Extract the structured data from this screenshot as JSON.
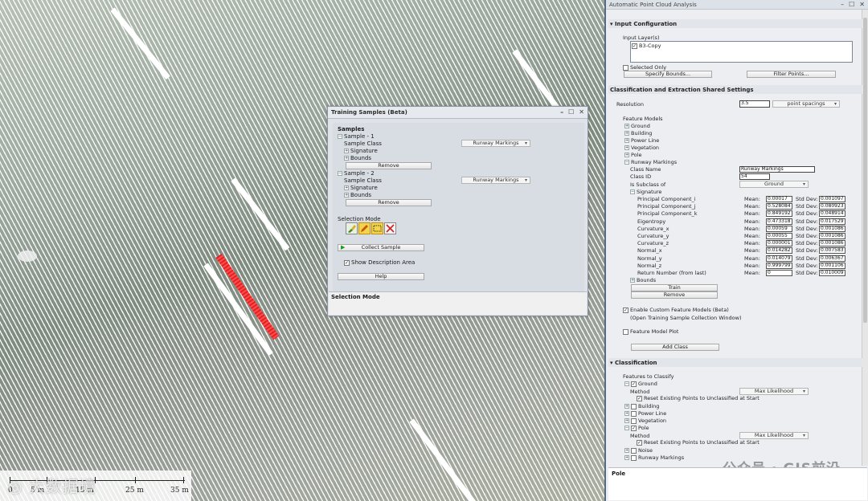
{
  "map": {
    "scale": {
      "labels": [
        "0",
        "5 m",
        "15 m",
        "25 m",
        "35 m"
      ],
      "watermark": "◎ 大数据境"
    }
  },
  "training": {
    "title": "Training Samples (Beta)",
    "samples_heading": "Samples",
    "samples": [
      {
        "label": "Sample - 1",
        "class_label": "Sample Class",
        "class_value": "Runway Markings",
        "signature": "Signature",
        "bounds": "Bounds",
        "remove": "Remove"
      },
      {
        "label": "Sample - 2",
        "class_label": "Sample Class",
        "class_value": "Runway Markings",
        "signature": "Signature",
        "bounds": "Bounds",
        "remove": "Remove"
      }
    ],
    "selection_mode_label": "Selection Mode",
    "collect_sample": "Collect Sample",
    "show_description": "Show Description Area",
    "help": "Help",
    "footer": "Selection Mode"
  },
  "panel": {
    "title": "Automatic Point Cloud Analysis",
    "input_config": {
      "heading": "Input Configuration",
      "input_layers_label": "Input Layer(s)",
      "layer": "B3-Copy",
      "selected_only": "Selected Only",
      "specify_bounds": "Specify Bounds...",
      "filter_points": "Filter Points..."
    },
    "shared": {
      "heading": "Classification and Extraction Shared Settings",
      "resolution_label": "Resolution",
      "resolution_value": "3.5",
      "resolution_unit": "point spacings",
      "feature_models_label": "Feature Models",
      "models": [
        "Ground",
        "Building",
        "Power Line",
        "Vegetation",
        "Pole",
        "Runway Markings"
      ],
      "class_name_label": "Class Name",
      "class_name_value": "Runway Markings",
      "class_id_label": "Class ID",
      "class_id_value": "54",
      "subclass_label": "Is Subclass of",
      "subclass_value": "Ground",
      "signature_label": "Signature",
      "mean_label": "Mean:",
      "std_label": "Std Dev:",
      "signature": [
        {
          "name": "Principal Component_i",
          "mean": "0.00017",
          "std": "0.001097"
        },
        {
          "name": "Principal Component_j",
          "mean": "0.528084",
          "std": "0.080923"
        },
        {
          "name": "Principal Component_k",
          "mean": "0.849192",
          "std": "0.048914"
        },
        {
          "name": "Eigentropy",
          "mean": "0.473318",
          "std": "0.017529"
        },
        {
          "name": "Curvature_x",
          "mean": "0.00059",
          "std": "0.001086"
        },
        {
          "name": "Curvature_y",
          "mean": "0.00055",
          "std": "0.001086"
        },
        {
          "name": "Curvature_z",
          "mean": "0.000001",
          "std": "0.001086"
        },
        {
          "name": "Normal_x",
          "mean": "0.014282",
          "std": "0.007583"
        },
        {
          "name": "Normal_y",
          "mean": "0.014079",
          "std": "0.006367"
        },
        {
          "name": "Normal_z",
          "mean": "0.999799",
          "std": "0.001106"
        },
        {
          "name": "Return Number (from last)",
          "mean": "0",
          "std": "0.010009"
        }
      ],
      "bounds_label": "Bounds",
      "train": "Train",
      "remove": "Remove",
      "enable_custom": "Enable Custom Feature Models (Beta)",
      "enable_custom_sub": "(Open Training Sample Collection Window)",
      "feature_model_plot": "Feature Model Plot",
      "add_class": "Add Class"
    },
    "classification": {
      "heading": "Classification",
      "features_label": "Features to Classify",
      "ground": "Ground",
      "method_label": "Method",
      "method_value": "Max Likelihood",
      "reset_label": "Reset Existing Points to Unclassified at Start",
      "building": "Building",
      "power_line": "Power Line",
      "vegetation": "Vegetation",
      "pole": "Pole",
      "noise": "Noise",
      "runway": "Runway Markings"
    },
    "description_footer": "Pole",
    "watermark": "公众号 · GIS前沿"
  },
  "colors": {
    "highlight": "#e22222",
    "panel_border": "#596b80"
  }
}
